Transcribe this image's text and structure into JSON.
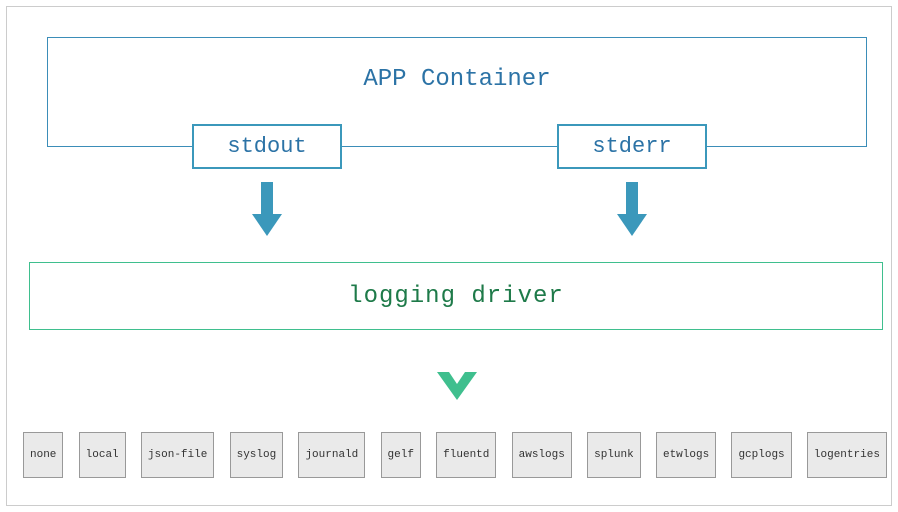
{
  "app_container": {
    "title": "APP Container",
    "streams": {
      "stdout": "stdout",
      "stderr": "stderr"
    }
  },
  "logging_driver": {
    "label": "logging  driver"
  },
  "drivers": [
    {
      "name": "none"
    },
    {
      "name": "local"
    },
    {
      "name": "json-file"
    },
    {
      "name": "syslog"
    },
    {
      "name": "journald"
    },
    {
      "name": "gelf"
    },
    {
      "name": "fluentd"
    },
    {
      "name": "awslogs"
    },
    {
      "name": "splunk"
    },
    {
      "name": "etwlogs"
    },
    {
      "name": "gcplogs"
    },
    {
      "name": "logentries"
    }
  ],
  "colors": {
    "blue": "#3b98bb",
    "green": "#3fbf8e",
    "green_text": "#1e7a49",
    "blue_text": "#2c73a6"
  }
}
